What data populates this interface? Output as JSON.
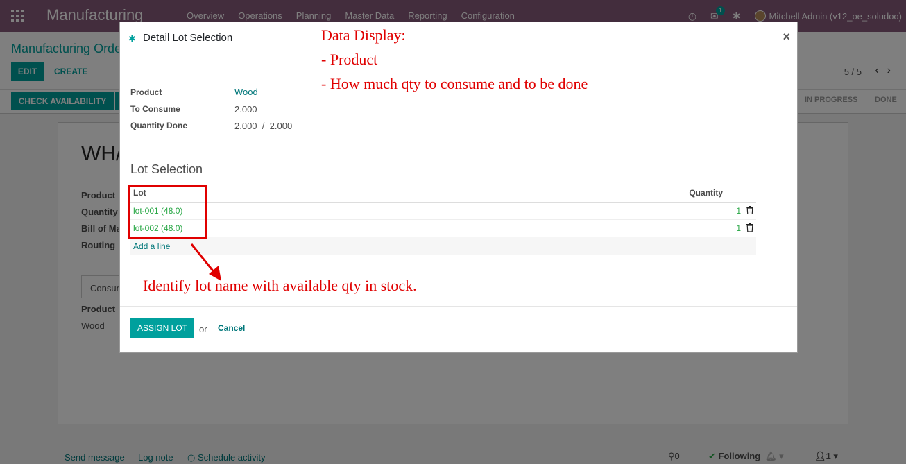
{
  "app": {
    "brand": "Manufacturing",
    "menu": [
      "Overview",
      "Operations",
      "Planning",
      "Master Data",
      "Reporting",
      "Configuration"
    ],
    "chat_badge": "1",
    "user": "Mitchell Admin (v12_oe_soludoo)"
  },
  "control": {
    "breadcrumb": "Manufacturing Orde",
    "edit_label": "EDIT",
    "create_label": "CREATE",
    "pager": "5 / 5"
  },
  "statusbar": {
    "check_label": "CHECK AVAILABILITY",
    "stages": [
      "IN PROGRESS",
      "DONE"
    ]
  },
  "sheet": {
    "title": "WH/",
    "fields": [
      "Product",
      "Quantity T",
      "Bill of Ma",
      "Routing"
    ],
    "tab": "Consun",
    "column": "Product",
    "cell": "Wood"
  },
  "chatter": {
    "send": "Send message",
    "log": "Log note",
    "schedule": "Schedule activity",
    "attachments": "0",
    "following": "Following",
    "followers": "1"
  },
  "modal": {
    "title": "Detail Lot Selection",
    "close": "×",
    "fields": {
      "product_label": "Product",
      "product_value": "Wood",
      "consume_label": "To Consume",
      "consume_value": "2.000",
      "done_label": "Quantity Done",
      "done_value": "2.000",
      "done_sep": "/",
      "done_total": "2.000"
    },
    "lot_heading": "Lot Selection",
    "table": {
      "col_lot": "Lot",
      "col_qty": "Quantity",
      "rows": [
        {
          "lot": "lot-001 (48.0)",
          "qty": "1"
        },
        {
          "lot": "lot-002 (48.0)",
          "qty": "1"
        }
      ],
      "add_line": "Add a line"
    },
    "footer": {
      "assign": "ASSIGN LOT",
      "or": "or",
      "cancel": "Cancel"
    }
  },
  "annotations": {
    "line1": "Data Display:",
    "line2": "- Product",
    "line3": "- How much qty to consume and to be done",
    "lot_note": "Identify lot name with available qty in stock.",
    "accent": "#e00000"
  },
  "colors": {
    "brand": "#875a7b",
    "primary": "#00a09d",
    "link": "#00777a",
    "success": "#28a745"
  }
}
